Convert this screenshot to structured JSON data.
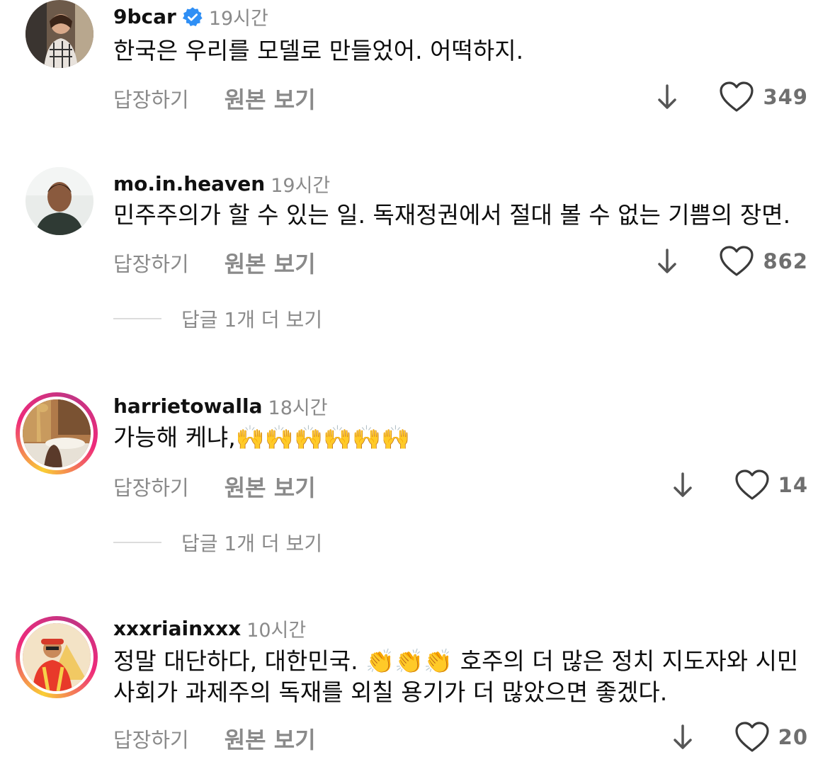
{
  "comments": [
    {
      "username": "9bcar",
      "time": "19시간",
      "verified": true,
      "text": "한국은 우리를 모델로 만들었어. 어떡하지.",
      "reply_label": "답장하기",
      "translate_label": "원본 보기",
      "likes": "349"
    },
    {
      "username": "mo.in.heaven",
      "time": "19시간",
      "verified": false,
      "text": "민주주의가 할 수 있는 일. 독재정권에서 절대 볼 수 없는 기쁨의 장면.",
      "reply_label": "답장하기",
      "translate_label": "원본 보기",
      "likes": "862",
      "more_replies": "답글 1개 더 보기"
    },
    {
      "username": "harrietowalla",
      "time": "18시간",
      "verified": false,
      "text": "가능해 케냐,🙌🙌🙌🙌🙌🙌",
      "reply_label": "답장하기",
      "translate_label": "원본 보기",
      "likes": "14",
      "more_replies": "답글 1개 더 보기"
    },
    {
      "username": "xxxriainxxx",
      "time": "10시간",
      "verified": false,
      "text": "정말 대단하다, 대한민국. 👏👏👏 호주의 더 많은 정치 지도자와 시민 사회가 과제주의 독재를 외칠 용기가 더 많았으면 좋겠다.",
      "reply_label": "답장하기",
      "translate_label": "원본 보기",
      "likes": "20"
    }
  ],
  "icons": {
    "verified": "verified-badge-icon",
    "down": "down-arrow-icon",
    "like": "heart-icon"
  },
  "colors": {
    "verified": "#2f8ff5",
    "secondary_text": "#8a8a8a"
  }
}
